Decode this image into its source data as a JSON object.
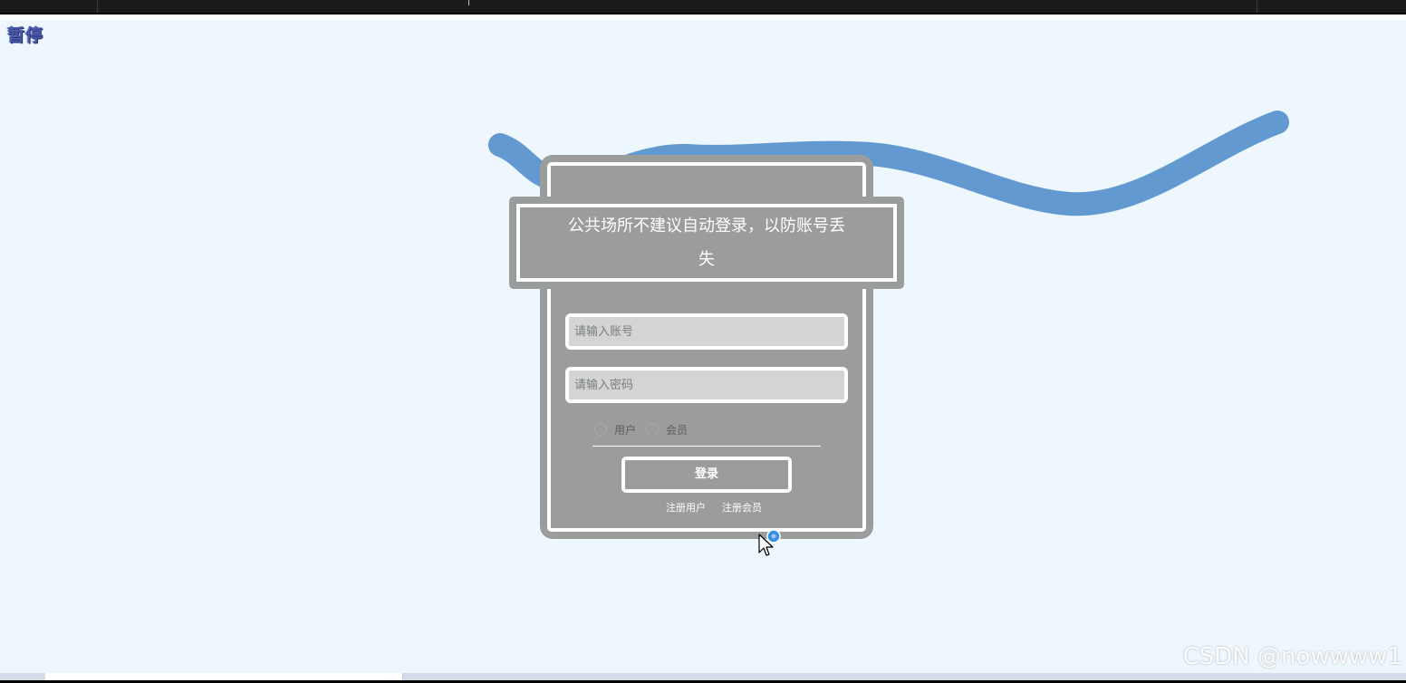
{
  "overlay": {
    "pause_label": "暂停"
  },
  "login": {
    "notice_text": "公共场所不建议自动登录，以防账号丢失",
    "account_placeholder": "请输入账号",
    "password_placeholder": "请输入密码",
    "roles": [
      {
        "label": "用户",
        "selected": false
      },
      {
        "label": "会员",
        "selected": false
      }
    ],
    "login_button": "登录",
    "links": [
      "注册用户",
      "注册会员"
    ]
  },
  "watermark": "CSDN @nowwww1",
  "colors": {
    "background": "#eef7fe",
    "card": "#9a9d9b",
    "wave": "#6399d1",
    "field": "#d2d5d2"
  }
}
